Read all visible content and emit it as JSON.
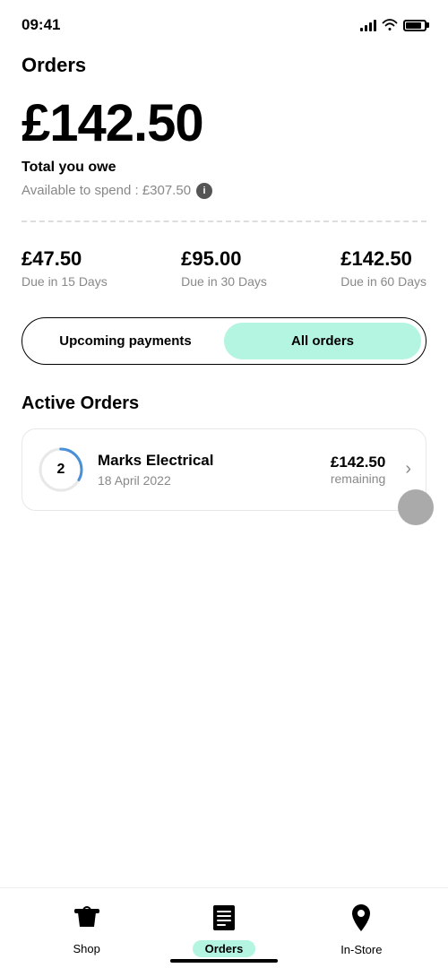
{
  "statusBar": {
    "time": "09:41"
  },
  "header": {
    "title": "Orders"
  },
  "summary": {
    "totalAmount": "£142.50",
    "totalLabel": "Total you owe",
    "availableSpend": "Available to spend : £307.50"
  },
  "duePeriods": [
    {
      "amount": "£47.50",
      "label": "Due in 15 Days"
    },
    {
      "amount": "£95.00",
      "label": "Due in 30 Days"
    },
    {
      "amount": "£142.50",
      "label": "Due in 60 Days"
    }
  ],
  "toggleButtons": [
    {
      "label": "Upcoming payments",
      "active": false
    },
    {
      "label": "All orders",
      "active": true
    }
  ],
  "activeOrders": {
    "sectionTitle": "Active Orders",
    "orders": [
      {
        "merchant": "Marks Electrical",
        "date": "18 April 2022",
        "amount": "£142.50",
        "remaining": "remaining",
        "progress": 2
      }
    ]
  },
  "bottomNav": [
    {
      "label": "Shop",
      "icon": "🛍",
      "active": false
    },
    {
      "label": "Orders",
      "icon": "📋",
      "active": true
    },
    {
      "label": "In-Store",
      "icon": "📍",
      "active": false
    }
  ]
}
